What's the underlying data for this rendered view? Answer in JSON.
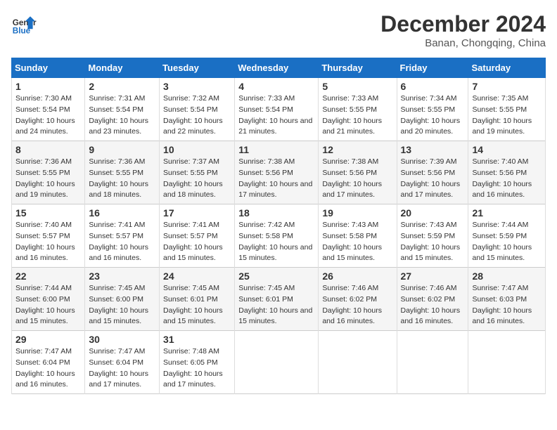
{
  "logo": {
    "line1": "General",
    "line2": "Blue"
  },
  "title": "December 2024",
  "subtitle": "Banan, Chongqing, China",
  "days_of_week": [
    "Sunday",
    "Monday",
    "Tuesday",
    "Wednesday",
    "Thursday",
    "Friday",
    "Saturday"
  ],
  "weeks": [
    [
      {
        "num": "1",
        "sunrise": "7:30 AM",
        "sunset": "5:54 PM",
        "daylight": "10 hours and 24 minutes."
      },
      {
        "num": "2",
        "sunrise": "7:31 AM",
        "sunset": "5:54 PM",
        "daylight": "10 hours and 23 minutes."
      },
      {
        "num": "3",
        "sunrise": "7:32 AM",
        "sunset": "5:54 PM",
        "daylight": "10 hours and 22 minutes."
      },
      {
        "num": "4",
        "sunrise": "7:33 AM",
        "sunset": "5:54 PM",
        "daylight": "10 hours and 21 minutes."
      },
      {
        "num": "5",
        "sunrise": "7:33 AM",
        "sunset": "5:55 PM",
        "daylight": "10 hours and 21 minutes."
      },
      {
        "num": "6",
        "sunrise": "7:34 AM",
        "sunset": "5:55 PM",
        "daylight": "10 hours and 20 minutes."
      },
      {
        "num": "7",
        "sunrise": "7:35 AM",
        "sunset": "5:55 PM",
        "daylight": "10 hours and 19 minutes."
      }
    ],
    [
      {
        "num": "8",
        "sunrise": "7:36 AM",
        "sunset": "5:55 PM",
        "daylight": "10 hours and 19 minutes."
      },
      {
        "num": "9",
        "sunrise": "7:36 AM",
        "sunset": "5:55 PM",
        "daylight": "10 hours and 18 minutes."
      },
      {
        "num": "10",
        "sunrise": "7:37 AM",
        "sunset": "5:55 PM",
        "daylight": "10 hours and 18 minutes."
      },
      {
        "num": "11",
        "sunrise": "7:38 AM",
        "sunset": "5:56 PM",
        "daylight": "10 hours and 17 minutes."
      },
      {
        "num": "12",
        "sunrise": "7:38 AM",
        "sunset": "5:56 PM",
        "daylight": "10 hours and 17 minutes."
      },
      {
        "num": "13",
        "sunrise": "7:39 AM",
        "sunset": "5:56 PM",
        "daylight": "10 hours and 17 minutes."
      },
      {
        "num": "14",
        "sunrise": "7:40 AM",
        "sunset": "5:56 PM",
        "daylight": "10 hours and 16 minutes."
      }
    ],
    [
      {
        "num": "15",
        "sunrise": "7:40 AM",
        "sunset": "5:57 PM",
        "daylight": "10 hours and 16 minutes."
      },
      {
        "num": "16",
        "sunrise": "7:41 AM",
        "sunset": "5:57 PM",
        "daylight": "10 hours and 16 minutes."
      },
      {
        "num": "17",
        "sunrise": "7:41 AM",
        "sunset": "5:57 PM",
        "daylight": "10 hours and 15 minutes."
      },
      {
        "num": "18",
        "sunrise": "7:42 AM",
        "sunset": "5:58 PM",
        "daylight": "10 hours and 15 minutes."
      },
      {
        "num": "19",
        "sunrise": "7:43 AM",
        "sunset": "5:58 PM",
        "daylight": "10 hours and 15 minutes."
      },
      {
        "num": "20",
        "sunrise": "7:43 AM",
        "sunset": "5:59 PM",
        "daylight": "10 hours and 15 minutes."
      },
      {
        "num": "21",
        "sunrise": "7:44 AM",
        "sunset": "5:59 PM",
        "daylight": "10 hours and 15 minutes."
      }
    ],
    [
      {
        "num": "22",
        "sunrise": "7:44 AM",
        "sunset": "6:00 PM",
        "daylight": "10 hours and 15 minutes."
      },
      {
        "num": "23",
        "sunrise": "7:45 AM",
        "sunset": "6:00 PM",
        "daylight": "10 hours and 15 minutes."
      },
      {
        "num": "24",
        "sunrise": "7:45 AM",
        "sunset": "6:01 PM",
        "daylight": "10 hours and 15 minutes."
      },
      {
        "num": "25",
        "sunrise": "7:45 AM",
        "sunset": "6:01 PM",
        "daylight": "10 hours and 15 minutes."
      },
      {
        "num": "26",
        "sunrise": "7:46 AM",
        "sunset": "6:02 PM",
        "daylight": "10 hours and 16 minutes."
      },
      {
        "num": "27",
        "sunrise": "7:46 AM",
        "sunset": "6:02 PM",
        "daylight": "10 hours and 16 minutes."
      },
      {
        "num": "28",
        "sunrise": "7:47 AM",
        "sunset": "6:03 PM",
        "daylight": "10 hours and 16 minutes."
      }
    ],
    [
      {
        "num": "29",
        "sunrise": "7:47 AM",
        "sunset": "6:04 PM",
        "daylight": "10 hours and 16 minutes."
      },
      {
        "num": "30",
        "sunrise": "7:47 AM",
        "sunset": "6:04 PM",
        "daylight": "10 hours and 17 minutes."
      },
      {
        "num": "31",
        "sunrise": "7:48 AM",
        "sunset": "6:05 PM",
        "daylight": "10 hours and 17 minutes."
      },
      null,
      null,
      null,
      null
    ]
  ]
}
